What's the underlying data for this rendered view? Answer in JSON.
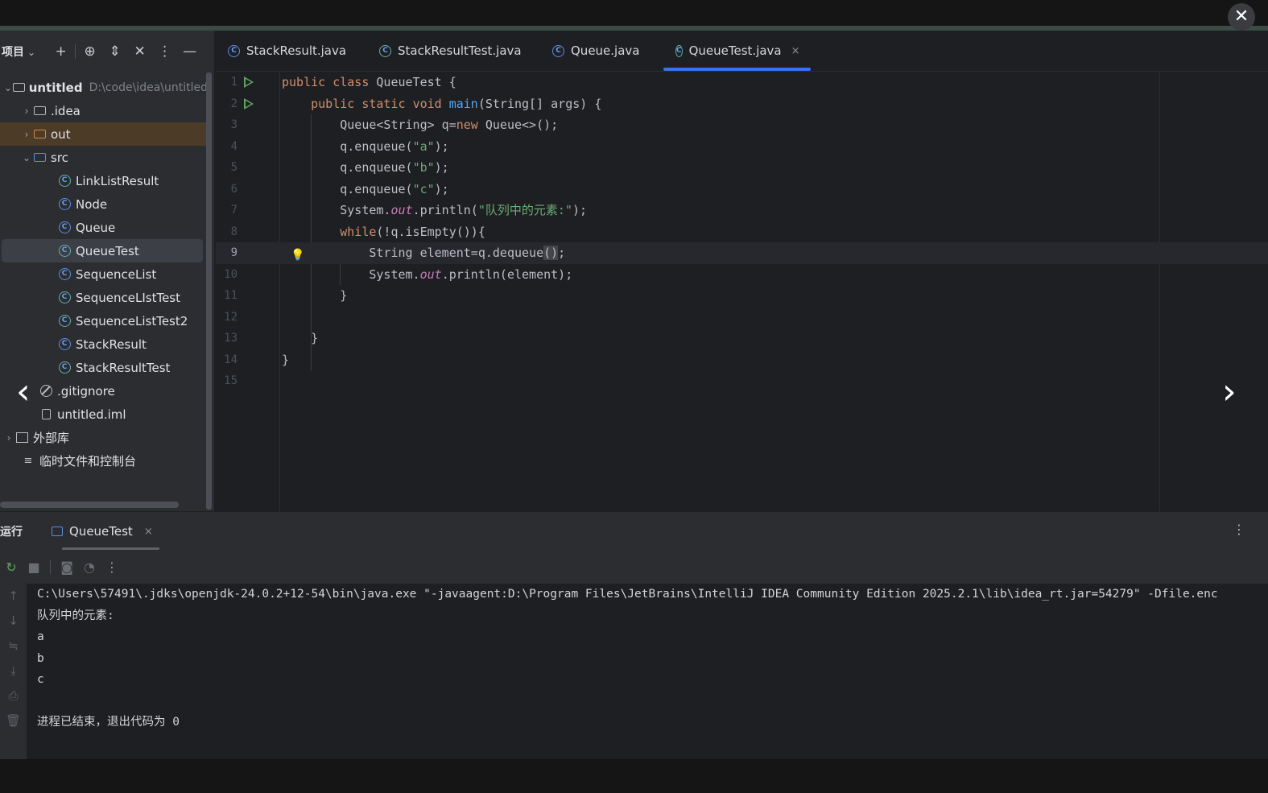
{
  "overlay": {
    "close_icon": "close-icon",
    "prev_icon": "chevron-left-icon",
    "next_icon": "chevron-right-icon"
  },
  "project_panel": {
    "title": "项目",
    "header_icons": [
      "plus-icon",
      "crosshair-icon",
      "expand-icon",
      "collapse-icon",
      "kebab-icon",
      "minimize-icon"
    ],
    "items": [
      {
        "label": "untitled",
        "path": "D:\\code\\idea\\untitled",
        "kind": "module"
      },
      {
        "label": ".idea",
        "kind": "folder"
      },
      {
        "label": "out",
        "kind": "folder-excluded"
      },
      {
        "label": "src",
        "kind": "folder-source"
      },
      {
        "label": "LinkListResult",
        "kind": "class-run"
      },
      {
        "label": "Node",
        "kind": "class"
      },
      {
        "label": "Queue",
        "kind": "class"
      },
      {
        "label": "QueueTest",
        "kind": "class-run",
        "selected": true
      },
      {
        "label": "SequenceList",
        "kind": "class"
      },
      {
        "label": "SequenceLIstTest",
        "kind": "class-run"
      },
      {
        "label": "SequenceListTest2",
        "kind": "class-run"
      },
      {
        "label": "StackResult",
        "kind": "class"
      },
      {
        "label": "StackResultTest",
        "kind": "class-run"
      },
      {
        "label": ".gitignore",
        "kind": "ignore-file"
      },
      {
        "label": "untitled.iml",
        "kind": "iml-file"
      },
      {
        "label": "外部库",
        "kind": "library"
      },
      {
        "label": "临时文件和控制台",
        "kind": "scratch"
      }
    ]
  },
  "editor": {
    "tabs": [
      {
        "label": "StackResult.java",
        "active": false
      },
      {
        "label": "StackResultTest.java",
        "active": false
      },
      {
        "label": "Queue.java",
        "active": false
      },
      {
        "label": "QueueTest.java",
        "active": true,
        "close": "×"
      }
    ],
    "line_numbers": [
      "1",
      "2",
      "3",
      "4",
      "5",
      "6",
      "7",
      "8",
      "9",
      "10",
      "11",
      "12",
      "13",
      "14",
      "15"
    ],
    "current_line": 9,
    "lines": [
      "public class QueueTest {",
      "    public static void main(String[] args) {",
      "        Queue<String> q=new Queue<>();",
      "        q.enqueue(\"a\");",
      "        q.enqueue(\"b\");",
      "        q.enqueue(\"c\");",
      "        System.out.println(\"队列中的元素:\");",
      "        while(!q.isEmpty()){",
      "            String element=q.dequeue();",
      "            System.out.println(element);",
      "        }",
      "",
      "    }",
      "}",
      ""
    ]
  },
  "run_panel": {
    "title": "运行",
    "tab": "QueueTest",
    "tab_close": "×",
    "toolbar_icons": [
      "rerun-icon",
      "stop-icon",
      "camera-icon",
      "coverage-icon",
      "kebab-icon"
    ],
    "side_icons": [
      "up-arrow-icon",
      "down-arrow-icon",
      "soft-wrap-icon",
      "scroll-to-end-icon",
      "print-icon",
      "trash-icon"
    ],
    "output": [
      "C:\\Users\\57491\\.jdks\\openjdk-24.0.2+12-54\\bin\\java.exe \"-javaagent:D:\\Program Files\\JetBrains\\IntelliJ IDEA Community Edition 2025.2.1\\lib\\idea_rt.jar=54279\" -Dfile.enc",
      "队列中的元素:",
      "a",
      "b",
      "c",
      "",
      "进程已结束，退出代码为 0"
    ]
  },
  "colors": {
    "accent": "#3574f0",
    "keyword": "#cf8e6d",
    "function": "#56a8f5",
    "string": "#6aab73",
    "static_field": "#c77dbb"
  }
}
